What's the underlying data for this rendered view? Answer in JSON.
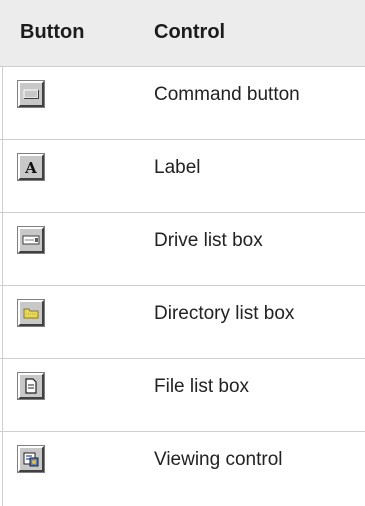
{
  "table": {
    "headers": {
      "button": "Button",
      "control": "Control"
    },
    "rows": [
      {
        "icon": "command-button-icon",
        "control": "Command button"
      },
      {
        "icon": "label-icon",
        "control": "Label",
        "glyph": "A"
      },
      {
        "icon": "drive-list-box-icon",
        "control": "Drive list box"
      },
      {
        "icon": "directory-list-box-icon",
        "control": "Directory list box"
      },
      {
        "icon": "file-list-box-icon",
        "control": "File list box"
      },
      {
        "icon": "viewing-control-icon",
        "control": "Viewing control"
      }
    ]
  },
  "colors": {
    "header_bg": "#ececec",
    "rule": "#cfcfcf",
    "button_face": "#c8c8c8",
    "folder_yellow": "#e8d858"
  }
}
